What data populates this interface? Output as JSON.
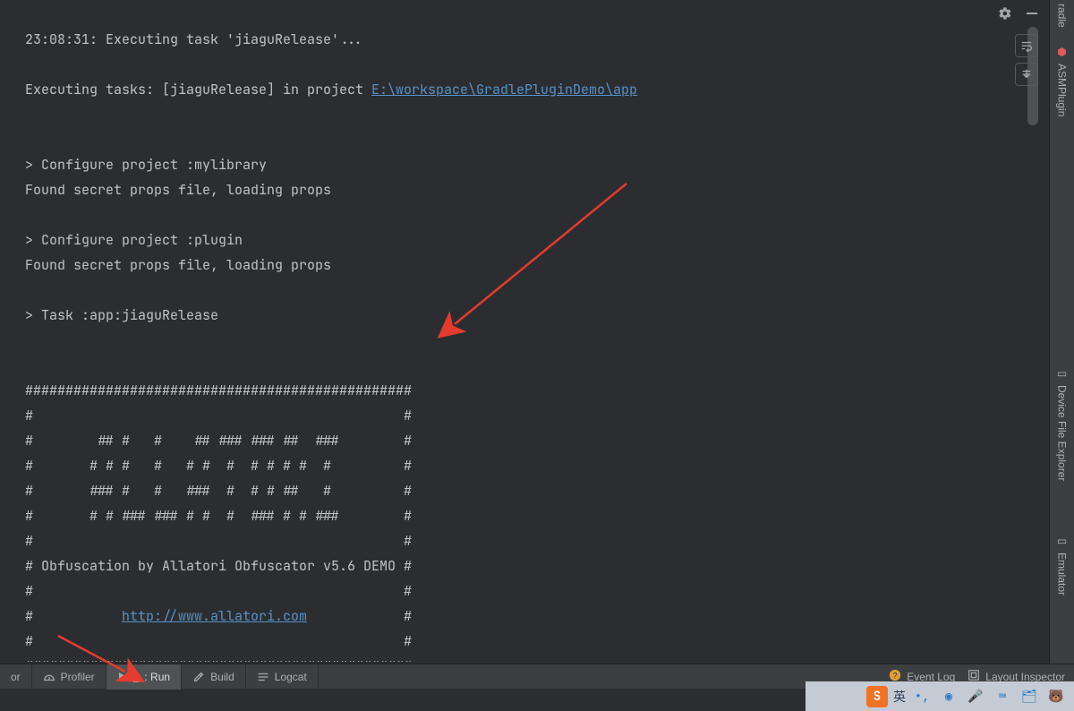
{
  "console": {
    "line1_prefix": "23:08:31: Executing task 'jiaguRelease'...",
    "line2_a": "Executing tasks: [jiaguRelease] in project ",
    "line2_link": "E:\\workspace\\GradlePluginDemo\\app",
    "line3": "> Configure project :mylibrary",
    "line4": "Found secret props file, loading props",
    "line5": "> Configure project :plugin",
    "line6": "Found secret props file, loading props",
    "line7": "> Task :app:jiaguRelease",
    "box_top": "################################################",
    "box_blank": "#                                              #",
    "box_l1": "#        ## #   #    ## ### ### ##  ###        #",
    "box_l2": "#       # # #   #   # #  #  # # # #  #         #",
    "box_l3": "#       ### #   #   ###  #  # # ##   #         #",
    "box_l4": "#       # # ### ### # #  #  ### # # ###        #",
    "box_about": "# Obfuscation by Allatori Obfuscator v5.6 DEMO #",
    "box_url_pre": "#           ",
    "box_url": "http://www.allatori.com",
    "box_url_post": "            #",
    "box_bot": "################################################"
  },
  "bottom_tabs": {
    "t0": "or",
    "profiler": "Profiler",
    "run_prefix": "4",
    "run_label": ": Run",
    "build": "Build",
    "logcat": "Logcat",
    "event_log": "Event Log",
    "layout_inspector": "Layout Inspector"
  },
  "right_tabs": {
    "gradle": "radle",
    "asm": "ASMPlugin",
    "device": "Device File Explorer",
    "emulator": "Emulator"
  },
  "taskbar": {
    "ime": "英"
  }
}
